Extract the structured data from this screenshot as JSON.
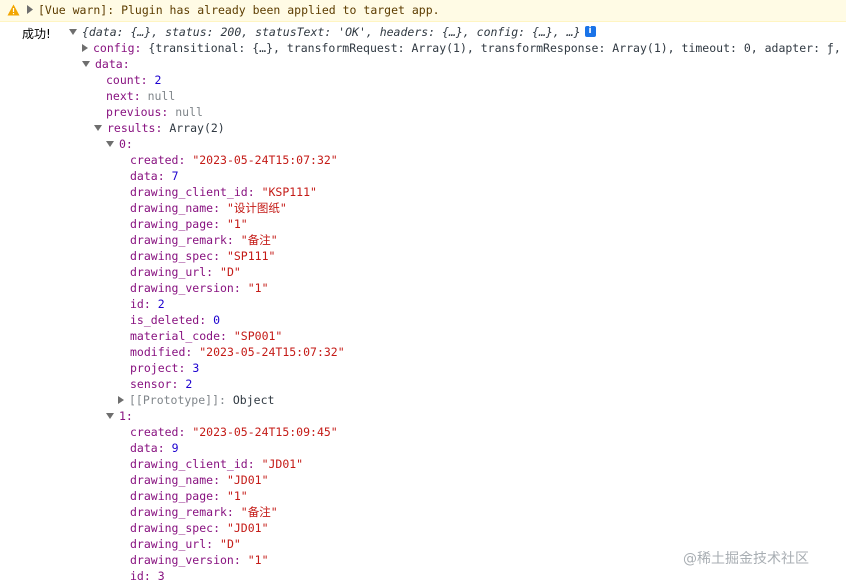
{
  "warning": {
    "text": "[Vue warn]: Plugin has already been applied to target app."
  },
  "log": {
    "prefix": "成功!",
    "summary": "{data: {…}, status: 200, statusText: 'OK', headers: {…}, config: {…}, …}",
    "info_icon_glyph": "i",
    "config_key": "config:",
    "config_preview": "{transitional: {…}, transformRequest: Array(1), transformResponse: Array(1), timeout: 0, adapter: ƒ, …}",
    "data_key": "data:",
    "count_key": "count:",
    "count_value": "2",
    "next_key": "next:",
    "next_value": "null",
    "previous_key": "previous:",
    "previous_value": "null",
    "results_key": "results:",
    "results_preview": "Array(2)",
    "item0_key": "0:",
    "item1_key": "1:",
    "prototype_key": "[[Prototype]]:",
    "prototype_value": "Object",
    "items": [
      {
        "created": "\"2023-05-24T15:07:32\"",
        "data": "7",
        "drawing_client_id": "\"KSP111\"",
        "drawing_name": "\"设计图纸\"",
        "drawing_page": "\"1\"",
        "drawing_remark": "\"备注\"",
        "drawing_spec": "\"SP111\"",
        "drawing_url": "\"D\"",
        "drawing_version": "\"1\"",
        "id": "2",
        "is_deleted": "0",
        "material_code": "\"SP001\"",
        "modified": "\"2023-05-24T15:07:32\"",
        "project": "3",
        "sensor": "2"
      },
      {
        "created": "\"2023-05-24T15:09:45\"",
        "data": "9",
        "drawing_client_id": "\"JD01\"",
        "drawing_name": "\"JD01\"",
        "drawing_page": "\"1\"",
        "drawing_remark": "\"备注\"",
        "drawing_spec": "\"JD01\"",
        "drawing_url": "\"D\"",
        "drawing_version": "\"1\"",
        "partial_key": "id: 3"
      }
    ],
    "field_labels": {
      "created": "created:",
      "data": "data:",
      "drawing_client_id": "drawing_client_id:",
      "drawing_name": "drawing_name:",
      "drawing_page": "drawing_page:",
      "drawing_remark": "drawing_remark:",
      "drawing_spec": "drawing_spec:",
      "drawing_url": "drawing_url:",
      "drawing_version": "drawing_version:",
      "id": "id:",
      "is_deleted": "is_deleted:",
      "material_code": "material_code:",
      "modified": "modified:",
      "project": "project:",
      "sensor": "sensor:"
    }
  },
  "watermark": "@稀土掘金技术社区"
}
